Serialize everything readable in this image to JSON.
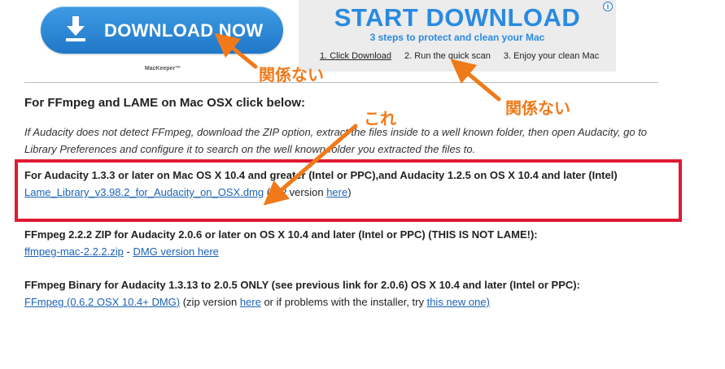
{
  "ad_left": {
    "button_label": "DOWNLOAD NOW",
    "brand": "MacKeeper™",
    "icon": "download-icon"
  },
  "ad_right": {
    "title": "START DOWNLOAD",
    "subtitle": "3 steps to protect and clean your Mac",
    "step1": "1. Click Download",
    "step2": "2. Run the quick scan",
    "step3": "3. Enjoy your clean Mac",
    "info_icon": "ⓘ"
  },
  "section": {
    "heading": "For FFmpeg and LAME on Mac OSX click below:",
    "intro": "If Audacity does not detect FFmpeg, download the ZIP option, extract the files inside to a well known folder, then open Audacity, go to Library Preferences and configure it to search on the well known folder you extracted the files to."
  },
  "lame": {
    "title": "For Audacity 1.3.3 or later on Mac OS X 10.4 and greater (Intel or PPC),and Audacity 1.2.5 on OS X 10.4 and later (Intel)",
    "link": "Lame_Library_v3.98.2_for_Audacity_on_OSX.dmg",
    "suffix_before": " (ZIP version ",
    "here": "here",
    "suffix_after": ")"
  },
  "ffmpeg222": {
    "title": "FFmpeg 2.2.2 ZIP for Audacity 2.0.6 or later on OS X 10.4 and later (Intel or PPC) (THIS IS NOT LAME!):",
    "zip_link": "ffmpeg-mac-2.2.2.zip",
    "sep": " - ",
    "dmg_link": "DMG version here"
  },
  "ffmpeg062": {
    "title": "FFmpeg Binary for Audacity 1.3.13 to 2.0.5 ONLY (see previous link for 2.0.6) OS X 10.4 and later (Intel or PPC):",
    "link": "FFmpeg (0.6.2 OSX 10.4+ DMG)",
    "text1": " (zip version ",
    "here": "here",
    "text2": " or if problems with the installer, try ",
    "new_link": "this new one)"
  },
  "annotations": {
    "not_related_1": "関係ない",
    "not_related_2": "関係ない",
    "this_one": "これ",
    "arrow_color": "#f07a1a",
    "box_color": "#e01932"
  }
}
